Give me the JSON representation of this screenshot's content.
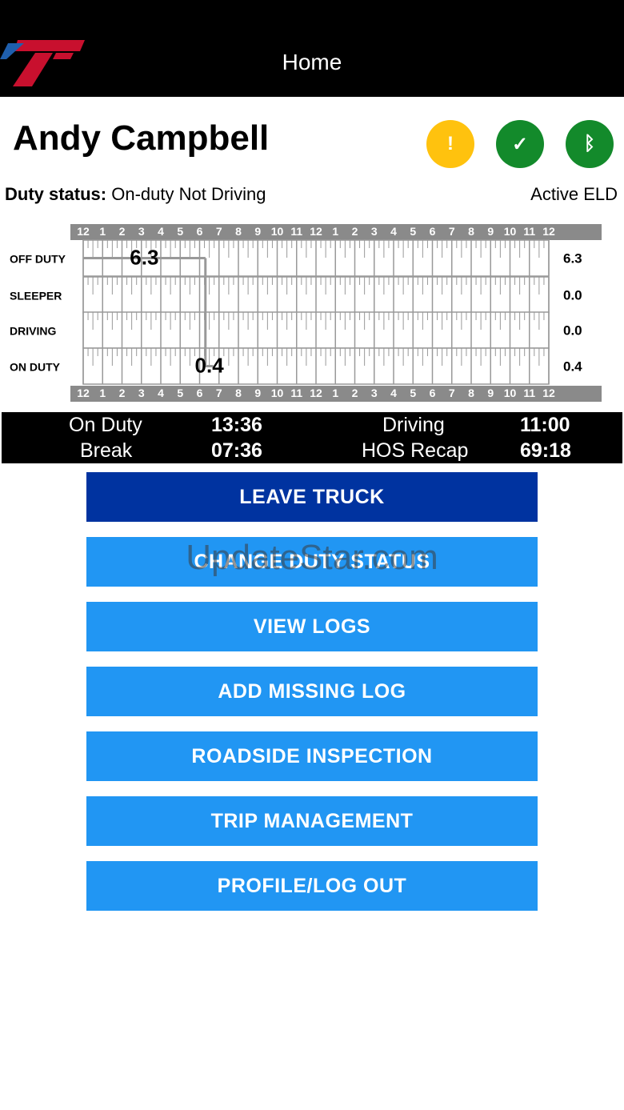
{
  "header": {
    "title": "Home"
  },
  "driver": {
    "name": "Andy Campbell"
  },
  "status_icons": [
    {
      "name": "alert-icon",
      "glyph": "!",
      "color": "#FFC20E"
    },
    {
      "name": "check-icon",
      "glyph": "✓",
      "color": "#138A2B"
    },
    {
      "name": "bluetooth-icon",
      "glyph": "ᛒ",
      "color": "#138A2B"
    }
  ],
  "duty": {
    "label": "Duty status:",
    "value": "On-duty Not Driving",
    "eld": "Active ELD"
  },
  "log_chart": {
    "hour_labels": [
      "12",
      "1",
      "2",
      "3",
      "4",
      "5",
      "6",
      "7",
      "8",
      "9",
      "10",
      "11",
      "12",
      "1",
      "2",
      "3",
      "4",
      "5",
      "6",
      "7",
      "8",
      "9",
      "10",
      "11",
      "12"
    ],
    "rows": [
      {
        "label": "OFF DUTY",
        "total": "6.3"
      },
      {
        "label": "SLEEPER",
        "total": "0.0"
      },
      {
        "label": "DRIVING",
        "total": "0.0"
      },
      {
        "label": "ON DUTY",
        "total": "0.4"
      }
    ],
    "segments": [
      {
        "row": 0,
        "start_hour": 0,
        "end_hour": 6.3,
        "label": "6.3"
      },
      {
        "row": 3,
        "start_hour": 6.3,
        "end_hour": 6.7,
        "label": "0.4"
      }
    ]
  },
  "summary": {
    "on_duty_label": "On Duty",
    "on_duty_value": "13:36",
    "driving_label": "Driving",
    "driving_value": "11:00",
    "break_label": "Break",
    "break_value": "07:36",
    "recap_label": "HOS Recap",
    "recap_value": "69:18"
  },
  "buttons": {
    "leave_truck": "LEAVE TRUCK",
    "change_duty": "CHANGE DUTY STATUS",
    "view_logs": "VIEW LOGS",
    "add_missing": "ADD MISSING LOG",
    "roadside": "ROADSIDE INSPECTION",
    "trip": "TRIP MANAGEMENT",
    "profile": "PROFILE/LOG OUT"
  },
  "watermark": "UpdateStar.com"
}
